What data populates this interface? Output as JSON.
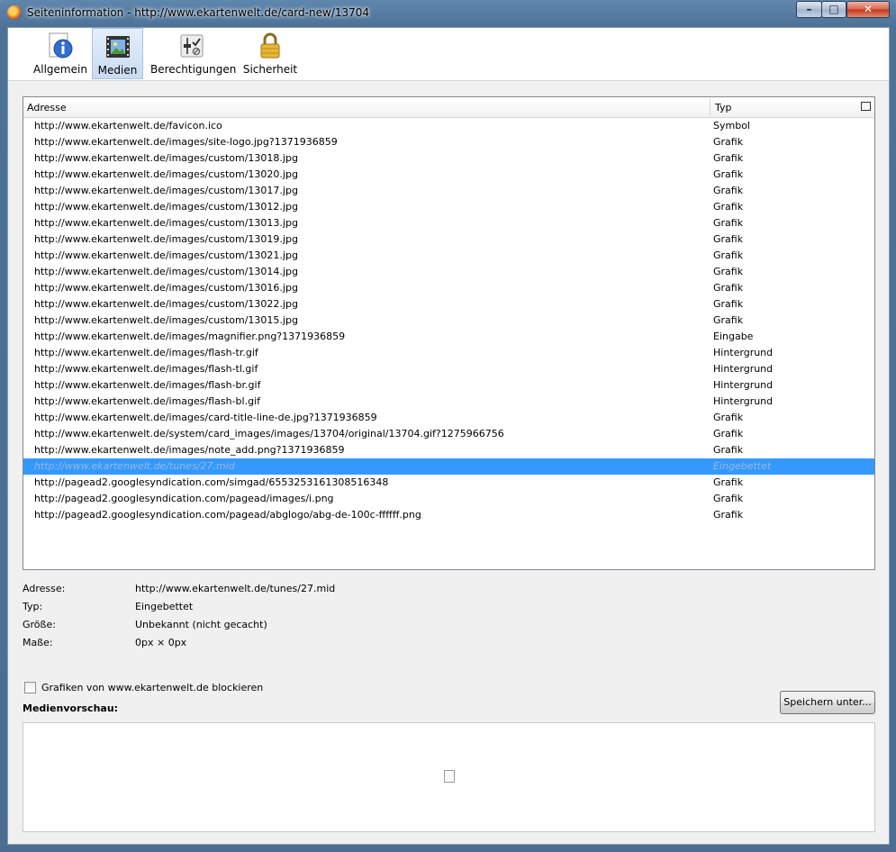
{
  "window": {
    "title": "Seiteninformation - http://www.ekartenwelt.de/card-new/13704"
  },
  "toolbar": {
    "tabs": [
      {
        "label": "Allgemein",
        "icon": "info-icon"
      },
      {
        "label": "Medien",
        "icon": "media-icon",
        "active": true
      },
      {
        "label": "Berechtigungen",
        "icon": "permissions-icon"
      },
      {
        "label": "Sicherheit",
        "icon": "lock-icon"
      }
    ]
  },
  "list": {
    "columns": {
      "address": "Adresse",
      "type": "Typ"
    },
    "rows": [
      {
        "url": "http://www.ekartenwelt.de/favicon.ico",
        "type": "Symbol"
      },
      {
        "url": "http://www.ekartenwelt.de/images/site-logo.jpg?1371936859",
        "type": "Grafik"
      },
      {
        "url": "http://www.ekartenwelt.de/images/custom/13018.jpg",
        "type": "Grafik"
      },
      {
        "url": "http://www.ekartenwelt.de/images/custom/13020.jpg",
        "type": "Grafik"
      },
      {
        "url": "http://www.ekartenwelt.de/images/custom/13017.jpg",
        "type": "Grafik"
      },
      {
        "url": "http://www.ekartenwelt.de/images/custom/13012.jpg",
        "type": "Grafik"
      },
      {
        "url": "http://www.ekartenwelt.de/images/custom/13013.jpg",
        "type": "Grafik"
      },
      {
        "url": "http://www.ekartenwelt.de/images/custom/13019.jpg",
        "type": "Grafik"
      },
      {
        "url": "http://www.ekartenwelt.de/images/custom/13021.jpg",
        "type": "Grafik"
      },
      {
        "url": "http://www.ekartenwelt.de/images/custom/13014.jpg",
        "type": "Grafik"
      },
      {
        "url": "http://www.ekartenwelt.de/images/custom/13016.jpg",
        "type": "Grafik"
      },
      {
        "url": "http://www.ekartenwelt.de/images/custom/13022.jpg",
        "type": "Grafik"
      },
      {
        "url": "http://www.ekartenwelt.de/images/custom/13015.jpg",
        "type": "Grafik"
      },
      {
        "url": "http://www.ekartenwelt.de/images/magnifier.png?1371936859",
        "type": "Eingabe"
      },
      {
        "url": "http://www.ekartenwelt.de/images/flash-tr.gif",
        "type": "Hintergrund"
      },
      {
        "url": "http://www.ekartenwelt.de/images/flash-tl.gif",
        "type": "Hintergrund"
      },
      {
        "url": "http://www.ekartenwelt.de/images/flash-br.gif",
        "type": "Hintergrund"
      },
      {
        "url": "http://www.ekartenwelt.de/images/flash-bl.gif",
        "type": "Hintergrund"
      },
      {
        "url": "http://www.ekartenwelt.de/images/card-title-line-de.jpg?1371936859",
        "type": "Grafik"
      },
      {
        "url": "http://www.ekartenwelt.de/system/card_images/images/13704/original/13704.gif?1275966756",
        "type": "Grafik"
      },
      {
        "url": "http://www.ekartenwelt.de/images/note_add.png?1371936859",
        "type": "Grafik"
      },
      {
        "url": "http://www.ekartenwelt.de/tunes/27.mid",
        "type": "Eingebettet",
        "selected": true
      },
      {
        "url": "http://pagead2.googlesyndication.com/simgad/6553253161308516348",
        "type": "Grafik"
      },
      {
        "url": "http://pagead2.googlesyndication.com/pagead/images/i.png",
        "type": "Grafik"
      },
      {
        "url": "http://pagead2.googlesyndication.com/pagead/abglogo/abg-de-100c-ffffff.png",
        "type": "Grafik"
      }
    ]
  },
  "details": {
    "address_label": "Adresse:",
    "address_value": "http://www.ekartenwelt.de/tunes/27.mid",
    "type_label": "Typ:",
    "type_value": "Eingebettet",
    "size_label": "Größe:",
    "size_value": "Unbekannt (nicht gecacht)",
    "dims_label": "Maße:",
    "dims_value": "0px × 0px"
  },
  "block_checkbox": {
    "label": "Grafiken von www.ekartenwelt.de blockieren",
    "checked": false
  },
  "save_button": {
    "label": "Speichern unter..."
  },
  "preview": {
    "label": "Medienvorschau:"
  },
  "colors": {
    "selection": "#3399ff",
    "titlebar": "#4d7298"
  }
}
